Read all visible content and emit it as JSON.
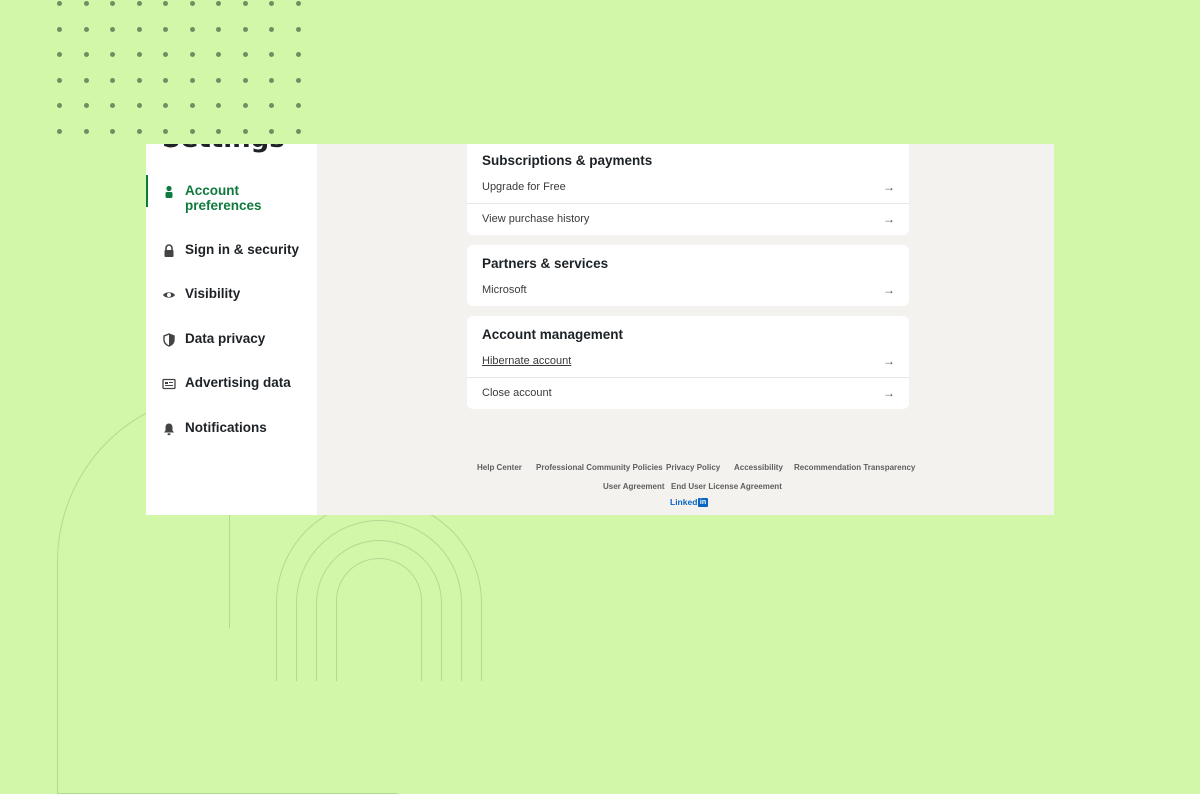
{
  "sidebar": {
    "title": "Settings",
    "items": [
      {
        "label": "Account preferences",
        "icon": "person-icon",
        "active": true
      },
      {
        "label": "Sign in & security",
        "icon": "lock-icon"
      },
      {
        "label": "Visibility",
        "icon": "eye-icon"
      },
      {
        "label": "Data privacy",
        "icon": "shield-icon"
      },
      {
        "label": "Advertising data",
        "icon": "newspaper-icon"
      },
      {
        "label": "Notifications",
        "icon": "bell-icon"
      }
    ]
  },
  "sections": {
    "subscriptions": {
      "title": "Subscriptions & payments",
      "rows": [
        "Upgrade for Free",
        "View purchase history"
      ]
    },
    "partners": {
      "title": "Partners & services",
      "rows": [
        "Microsoft"
      ]
    },
    "account_management": {
      "title": "Account management",
      "rows": [
        "Hibernate account",
        "Close account"
      ]
    }
  },
  "footer": {
    "links_row1": [
      "Help Center",
      "Professional Community Policies",
      "Privacy Policy",
      "Accessibility",
      "Recommendation Transparency"
    ],
    "links_row2": [
      "User Agreement",
      "End User License Agreement"
    ],
    "logo_text": "Linked",
    "logo_badge": "in"
  },
  "colors": {
    "background": "#d2f7a9",
    "accent": "#0f7a3e",
    "brand": "#0a66c2"
  }
}
